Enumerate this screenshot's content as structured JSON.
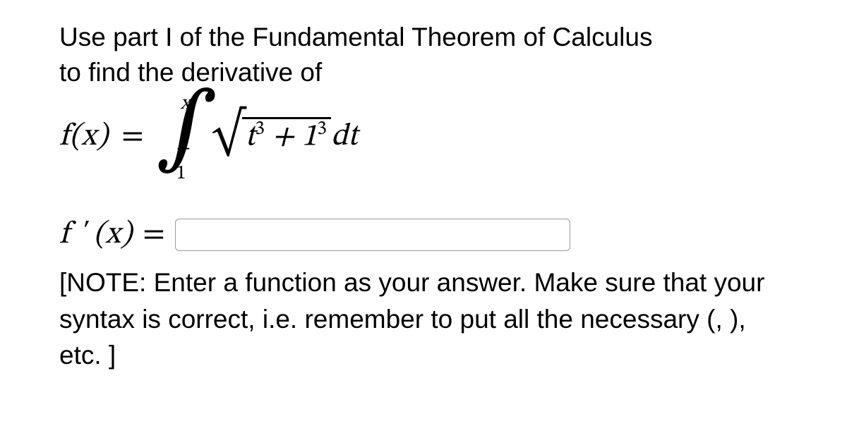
{
  "prompt": {
    "line1": "Use part I of the Fundamental Theorem of Calculus",
    "line2": "to find the derivative of"
  },
  "equation": {
    "lhs": "f(x)",
    "equals": "=",
    "integral_lower": "− 1",
    "integral_upper": "x",
    "radicand_part1": "t",
    "radicand_exp1": "3",
    "radicand_plus": " + 1",
    "radicand_exp2": "3",
    "dt": "dt"
  },
  "answer": {
    "label": "f ' (x)",
    "equals": "=",
    "value": ""
  },
  "note": "[NOTE: Enter a function as your answer. Make sure that your syntax is correct, i.e. remember to put all the necessary (, ), etc. ]"
}
